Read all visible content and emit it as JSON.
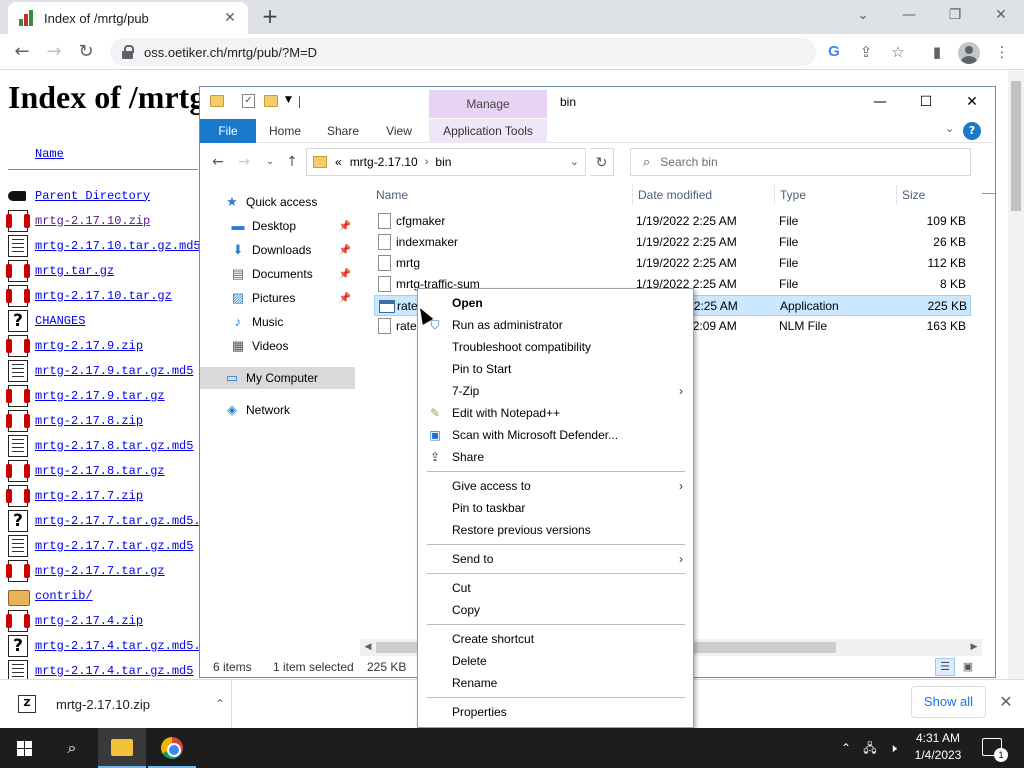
{
  "browser": {
    "tab_title": "Index of /mrtg/pub",
    "tab_close": "✕",
    "new_tab": "+",
    "url": "oss.oetiker.ch/mrtg/pub/?M=D"
  },
  "webpage": {
    "title": "Index of /mrtg/pub",
    "column_name": "Name",
    "entries": [
      {
        "icon": "back",
        "name": "Parent Directory"
      },
      {
        "icon": "zip",
        "name": "mrtg-2.17.10.zip"
      },
      {
        "icon": "txt",
        "name": "mrtg-2.17.10.tar.gz.md5"
      },
      {
        "icon": "zip",
        "name": "mrtg.tar.gz"
      },
      {
        "icon": "zip",
        "name": "mrtg-2.17.10.tar.gz"
      },
      {
        "icon": "unk",
        "name": "CHANGES"
      },
      {
        "icon": "zip",
        "name": "mrtg-2.17.9.zip"
      },
      {
        "icon": "txt",
        "name": "mrtg-2.17.9.tar.gz.md5"
      },
      {
        "icon": "zip",
        "name": "mrtg-2.17.9.tar.gz"
      },
      {
        "icon": "zip",
        "name": "mrtg-2.17.8.zip"
      },
      {
        "icon": "txt",
        "name": "mrtg-2.17.8.tar.gz.md5"
      },
      {
        "icon": "zip",
        "name": "mrtg-2.17.8.tar.gz"
      },
      {
        "icon": "zip",
        "name": "mrtg-2.17.7.zip"
      },
      {
        "icon": "unk",
        "name": "mrtg-2.17.7.tar.gz.md5."
      },
      {
        "icon": "txt",
        "name": "mrtg-2.17.7.tar.gz.md5"
      },
      {
        "icon": "zip",
        "name": "mrtg-2.17.7.tar.gz"
      },
      {
        "icon": "folder",
        "name": "contrib/"
      },
      {
        "icon": "zip",
        "name": "mrtg-2.17.4.zip"
      },
      {
        "icon": "unk",
        "name": "mrtg-2.17.4.tar.gz.md5."
      },
      {
        "icon": "txt",
        "name": "mrtg-2.17.4.tar.gz.md5"
      }
    ]
  },
  "downloads": {
    "file_name": "mrtg-2.17.10.zip",
    "show_all": "Show all",
    "close": "✕"
  },
  "explorer": {
    "contextual_tab_header": "Manage",
    "window_title": "bin",
    "ribbon_tabs": [
      "File",
      "Home",
      "Share",
      "View",
      "Application Tools"
    ],
    "breadcrumb": [
      "«",
      "mrtg-2.17.10",
      "bin"
    ],
    "search_placeholder": "Search bin",
    "nav_pane": [
      {
        "label": "Quick access",
        "icon": "star-icon"
      },
      {
        "label": "Desktop",
        "icon": "desktop-icon",
        "pinned": true
      },
      {
        "label": "Downloads",
        "icon": "download-icon",
        "pinned": true
      },
      {
        "label": "Documents",
        "icon": "document-icon",
        "pinned": true
      },
      {
        "label": "Pictures",
        "icon": "pictures-icon",
        "pinned": true
      },
      {
        "label": "Music",
        "icon": "music-icon"
      },
      {
        "label": "Videos",
        "icon": "videos-icon"
      },
      {
        "label": "My Computer",
        "icon": "computer-icon",
        "selected": true
      },
      {
        "label": "Network",
        "icon": "network-icon"
      }
    ],
    "columns": [
      "Name",
      "Date modified",
      "Type",
      "Size"
    ],
    "files": [
      {
        "name": "cfgmaker",
        "date": "1/19/2022 2:25 AM",
        "type": "File",
        "size": "109 KB"
      },
      {
        "name": "indexmaker",
        "date": "1/19/2022 2:25 AM",
        "type": "File",
        "size": "26 KB"
      },
      {
        "name": "mrtg",
        "date": "1/19/2022 2:25 AM",
        "type": "File",
        "size": "112 KB"
      },
      {
        "name": "mrtg-traffic-sum",
        "date": "1/19/2022 2:25 AM",
        "type": "File",
        "size": "8 KB"
      },
      {
        "name": "rateup",
        "date": "1/19/2022 2:25 AM",
        "type": "Application",
        "size": "225 KB",
        "selected": true
      },
      {
        "name": "rateup",
        "date": "1/19/2022 2:09 AM",
        "type": "NLM File",
        "size": "163 KB"
      }
    ],
    "status": {
      "items": "6 items",
      "selected": "1 item selected",
      "size": "225 KB"
    }
  },
  "context_menu": {
    "items": [
      {
        "label": "Open",
        "bold": true
      },
      {
        "label": "Run as administrator",
        "icon": "shield-icon"
      },
      {
        "label": "Troubleshoot compatibility"
      },
      {
        "label": "Pin to Start"
      },
      {
        "label": "7-Zip",
        "submenu": true
      },
      {
        "label": "Edit with Notepad++",
        "icon": "notepad-icon"
      },
      {
        "label": "Scan with Microsoft Defender...",
        "icon": "defender-icon"
      },
      {
        "label": "Share",
        "icon": "share-icon"
      },
      {
        "separator": true
      },
      {
        "label": "Give access to",
        "submenu": true
      },
      {
        "label": "Pin to taskbar"
      },
      {
        "label": "Restore previous versions"
      },
      {
        "separator": true
      },
      {
        "label": "Send to",
        "submenu": true
      },
      {
        "separator": true
      },
      {
        "label": "Cut"
      },
      {
        "label": "Copy"
      },
      {
        "separator": true
      },
      {
        "label": "Create shortcut"
      },
      {
        "label": "Delete"
      },
      {
        "label": "Rename"
      },
      {
        "separator": true
      },
      {
        "label": "Properties"
      }
    ]
  },
  "taskbar": {
    "time": "4:31 AM",
    "date": "1/4/2023",
    "notification_count": "1"
  },
  "colors": {
    "ribbon_file": "#1979ca",
    "selection": "#cce8ff",
    "link": "#0000ee",
    "taskbar": "#1d1d1d"
  }
}
